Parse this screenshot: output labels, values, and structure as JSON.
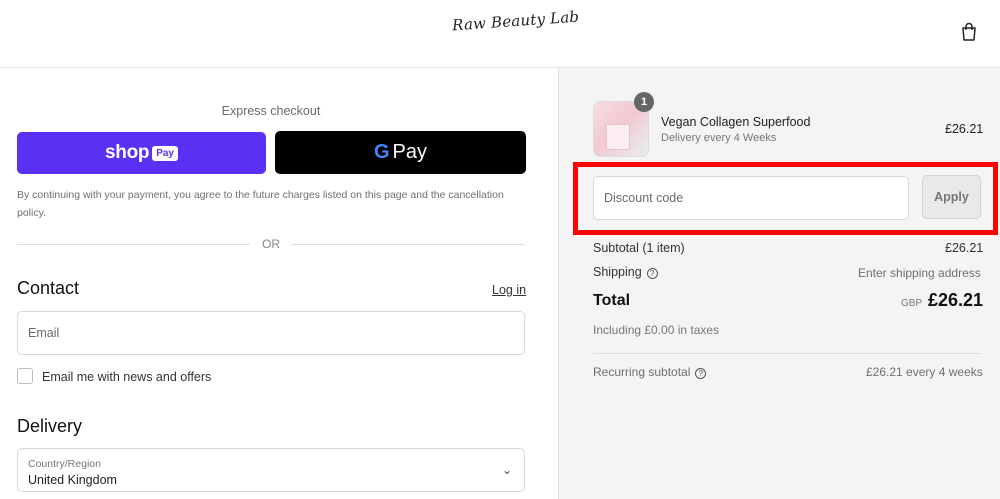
{
  "header": {
    "logo_text": "Raw Beauty Lab",
    "cart_icon": "shopping-bag-icon"
  },
  "express": {
    "title": "Express checkout",
    "shop_pay": {
      "word": "shop",
      "badge": "Pay",
      "color": "#5a31f4"
    },
    "google_pay": {
      "g": "G",
      "word": "Pay",
      "color": "#000000"
    },
    "consent": "By continuing with your payment, you agree to the future charges listed on this page and the cancellation policy.",
    "or": "OR"
  },
  "contact": {
    "heading": "Contact",
    "login_link": "Log in",
    "email_placeholder": "Email",
    "newsletter_label": "Email me with news and offers"
  },
  "delivery": {
    "heading": "Delivery",
    "country_label": "Country/Region",
    "country_value": "United Kingdom"
  },
  "summary": {
    "product": {
      "name": "Vegan Collagen Superfood",
      "subtitle": "Delivery every 4 Weeks",
      "price": "£26.21",
      "quantity": "1"
    },
    "discount": {
      "placeholder": "Discount code",
      "apply_label": "Apply",
      "highlight_color": "#ff0000"
    },
    "subtotal_label": "Subtotal (1 item)",
    "subtotal_value": "£26.21",
    "shipping_label": "Shipping",
    "shipping_value": "Enter shipping address",
    "total_label": "Total",
    "currency": "GBP",
    "total_value": "£26.21",
    "taxes": "Including £0.00 in taxes",
    "recurring_label": "Recurring subtotal",
    "recurring_value": "£26.21 every 4 weeks"
  }
}
